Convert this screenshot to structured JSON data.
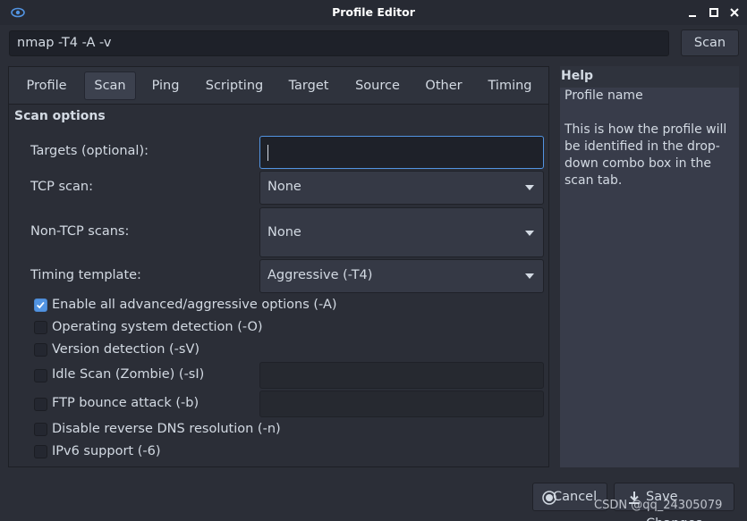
{
  "window": {
    "title": "Profile Editor",
    "icon": "eye-icon",
    "controls": [
      "minimize-icon",
      "maximize-icon",
      "close-icon"
    ]
  },
  "command": {
    "value": "nmap -T4 -A -v",
    "scan_label": "Scan"
  },
  "tabs": [
    {
      "label": "Profile",
      "active": false
    },
    {
      "label": "Scan",
      "active": true
    },
    {
      "label": "Ping",
      "active": false
    },
    {
      "label": "Scripting",
      "active": false
    },
    {
      "label": "Target",
      "active": false
    },
    {
      "label": "Source",
      "active": false
    },
    {
      "label": "Other",
      "active": false
    },
    {
      "label": "Timing",
      "active": false
    }
  ],
  "scan_options": {
    "title": "Scan options",
    "targets_label": "Targets (optional):",
    "targets_value": "",
    "tcp_scan_label": "TCP scan:",
    "tcp_scan_value": "None",
    "non_tcp_label": "Non-TCP scans:",
    "non_tcp_value": "None",
    "timing_label": "Timing template:",
    "timing_value": "Aggressive (-T4)",
    "checkboxes": [
      {
        "label": "Enable all advanced/aggressive options (-A)",
        "checked": true
      },
      {
        "label": "Operating system detection (-O)",
        "checked": false
      },
      {
        "label": "Version detection (-sV)",
        "checked": false
      },
      {
        "label": "Idle Scan (Zombie) (-sI)",
        "checked": false
      },
      {
        "label": "FTP bounce attack (-b)",
        "checked": false
      },
      {
        "label": "Disable reverse DNS resolution (-n)",
        "checked": false
      },
      {
        "label": "IPv6 support (-6)",
        "checked": false
      }
    ]
  },
  "help": {
    "title": "Help",
    "heading": "Profile name",
    "body": "This is how the profile will be identified in the drop-down combo box in the scan tab."
  },
  "footer": {
    "cancel_label": "Cancel",
    "save_label": "Save Changes"
  },
  "watermark": "CSDN @qq_24305079",
  "colors": {
    "accent": "#5294e2",
    "background": "#2b2e37",
    "text": "#d3dae3"
  }
}
